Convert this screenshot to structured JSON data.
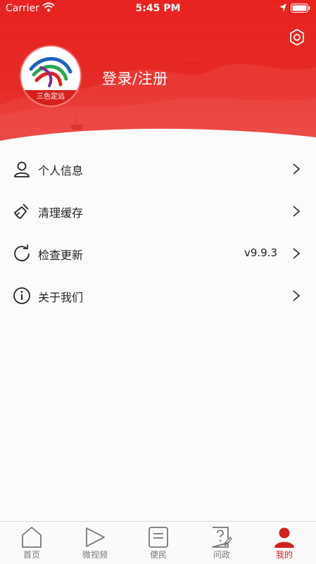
{
  "status_bar": {
    "carrier": "Carrier",
    "time": "5:45 PM"
  },
  "header": {
    "logo_text": "三色定远",
    "login_label": "登录/注册"
  },
  "menu": [
    {
      "label": "个人信息",
      "icon": "user-icon"
    },
    {
      "label": "清理缓存",
      "icon": "broom-icon"
    },
    {
      "label": "检查更新",
      "icon": "refresh-icon",
      "value": "v9.9.3"
    },
    {
      "label": "关于我们",
      "icon": "info-icon"
    }
  ],
  "tabbar": {
    "active_index": 4,
    "tabs": [
      {
        "label": "首页",
        "icon": "home-icon"
      },
      {
        "label": "微视频",
        "icon": "play-icon"
      },
      {
        "label": "便民",
        "icon": "document-icon"
      },
      {
        "label": "问政",
        "icon": "question-icon"
      },
      {
        "label": "我的",
        "icon": "person-icon"
      }
    ]
  },
  "colors": {
    "brand_red": "#e62a26",
    "active_tab": "#d4201c",
    "inactive_tab": "#777777"
  }
}
